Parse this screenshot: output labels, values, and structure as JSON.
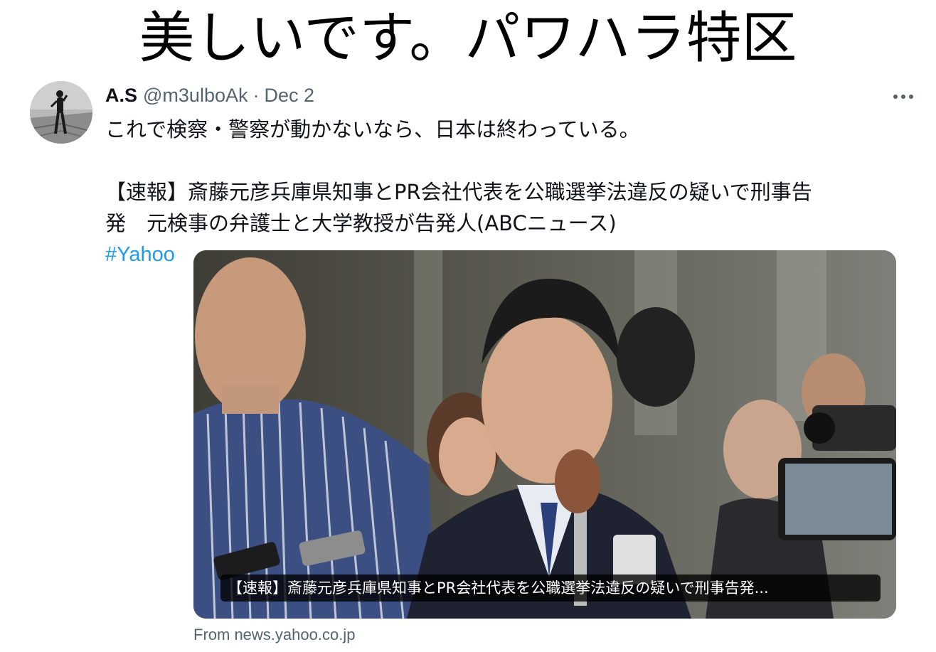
{
  "headline": "美しいです。パワハラ特区",
  "tweet": {
    "display_name": "A.S",
    "handle": "@m3ulboAk",
    "separator": "·",
    "date": "Dec 2",
    "more_icon": "more-horizontal-icon",
    "text_line1": "これで検察・警察が動かないなら、日本は終わっている。",
    "text_line2": "【速報】斎藤元彦兵庫県知事とPR会社代表を公職選挙法違反の疑いで刑事告",
    "text_line3": "発　元検事の弁護士と大学教授が告発人(ABCニュース)",
    "hashtag": "#Yahoo",
    "link_card": {
      "caption": "【速報】斎藤元彦兵庫県知事とPR会社代表を公職選挙法違反の疑いで刑事告発...",
      "source": "From news.yahoo.co.jp"
    }
  },
  "colors": {
    "text_primary": "#0f1419",
    "text_secondary": "#536471",
    "link": "#1d9bf0"
  }
}
